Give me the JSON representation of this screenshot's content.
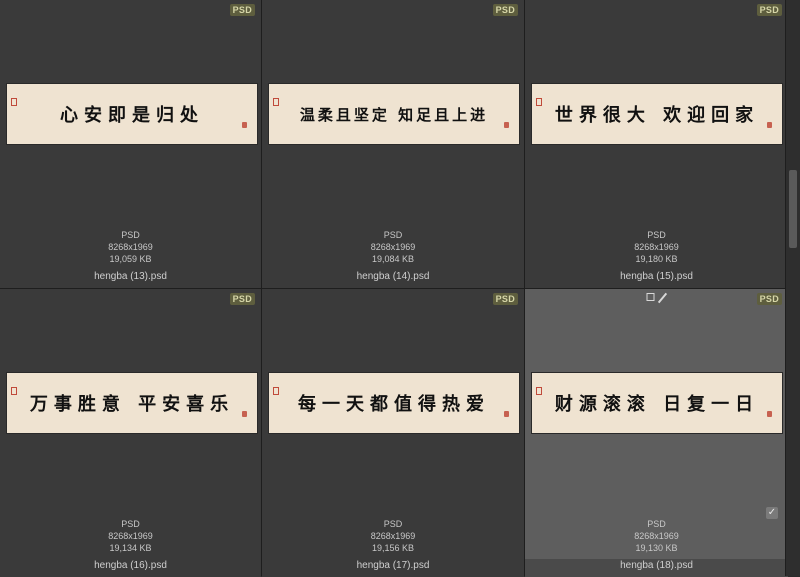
{
  "items": [
    {
      "badge": "PSD",
      "text": "心安即是归处",
      "type": "PSD",
      "dims": "8268x1969",
      "size": "19,059 KB",
      "name": "hengba (13).psd"
    },
    {
      "badge": "PSD",
      "text": "温柔且坚定 知足且上进",
      "type": "PSD",
      "dims": "8268x1969",
      "size": "19,084 KB",
      "name": "hengba (14).psd"
    },
    {
      "badge": "PSD",
      "text": "世界很大 欢迎回家",
      "type": "PSD",
      "dims": "8268x1969",
      "size": "19,180 KB",
      "name": "hengba (15).psd"
    },
    {
      "badge": "PSD",
      "text": "万事胜意 平安喜乐",
      "type": "PSD",
      "dims": "8268x1969",
      "size": "19,134 KB",
      "name": "hengba (16).psd"
    },
    {
      "badge": "PSD",
      "text": "每一天都值得热爱",
      "type": "PSD",
      "dims": "8268x1969",
      "size": "19,156 KB",
      "name": "hengba (17).psd"
    },
    {
      "badge": "PSD",
      "text": "财源滚滚 日复一日",
      "type": "PSD",
      "dims": "8268x1969",
      "size": "19,130 KB",
      "name": "hengba (18).psd"
    }
  ],
  "selected_check": "✓"
}
